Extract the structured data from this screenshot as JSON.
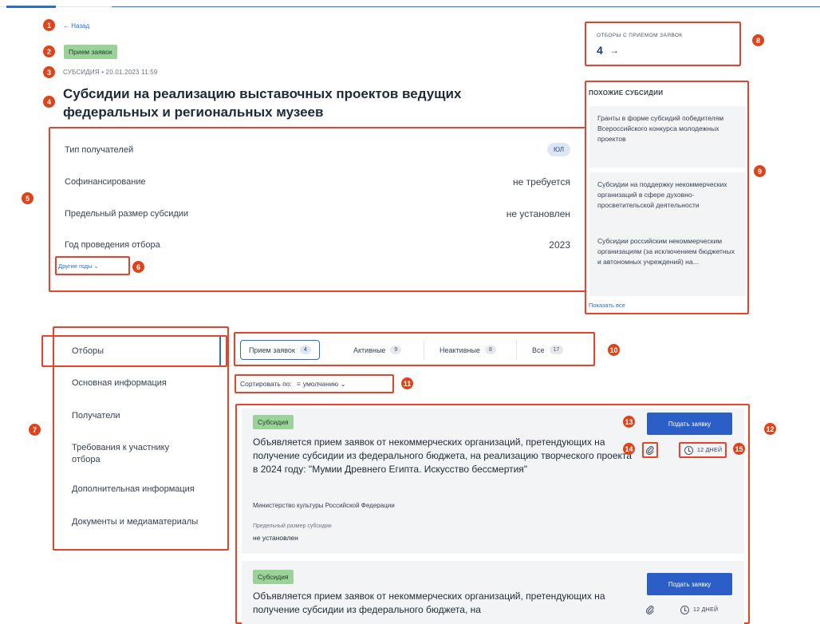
{
  "header": {
    "back": "← Назад",
    "status": "Прием заявок",
    "meta": "СУБСИДИЯ • 20.01.2023 11:59",
    "title": "Субсидии на реализацию выставочных проектов ведущих федеральных и региональных музеев"
  },
  "info": {
    "rows": [
      {
        "label": "Тип получателей",
        "value": "ЮЛ"
      },
      {
        "label": "Софинансирование",
        "value": "не требуется"
      },
      {
        "label": "Предельный размер субсидии",
        "value": "не установлен"
      },
      {
        "label": "Год проведения отбора",
        "value": "2023"
      }
    ],
    "other_years": "Другие годы ⌄"
  },
  "selections": {
    "label": "ОТБОРЫ С ПРИЕМОМ ЗАЯВОК",
    "count": "4",
    "arrow": "→"
  },
  "similar": {
    "title": "ПОХОЖИЕ СУБСИДИИ",
    "items": [
      "Гранты в форме субсидий победителям Всероссийского конкурса молодежных проектов",
      "Субсидии на поддержку некоммерческих организаций в сфере духовно-просветительской деятельности",
      "Субсидии российским некоммерческим организациям (за исключением бюджетных и автономных учреждений) на..."
    ],
    "show_all": "Показать все"
  },
  "nav": {
    "items": [
      "Отборы",
      "Основная информация",
      "Получатели",
      "Требования к участнику отбора",
      "Дополнительная информация",
      "Документы и медиаматериалы"
    ]
  },
  "tabs": [
    {
      "label": "Прием заявок",
      "count": "4"
    },
    {
      "label": "Активные",
      "count": "9"
    },
    {
      "label": "Неактивные",
      "count": "8"
    },
    {
      "label": "Все",
      "count": "17"
    }
  ],
  "sort": {
    "label": "Сортировать по:",
    "icon": "≡",
    "value": "умолчанию ⌄"
  },
  "cards": [
    {
      "chip": "Субсидия",
      "title": "Объявляется прием заявок от некоммерческих организаций, претендующих на получение субсидии из федерального бюджета, на реализацию творческого проекта в 2024 году: \"Мумии Древнего Египта. Искусство бессмертия\"",
      "ministry": "Министерство культуры Российской Федерации",
      "limit_label": "Предельный размер субсидии",
      "limit_value": "не установлен",
      "apply": "Подать заявку",
      "days": "12 ДНЕЙ"
    },
    {
      "chip": "Субсидия",
      "title": "Объявляется прием заявок от некоммерческих организаций, претендующих на получение субсидии из федерального бюджета, на",
      "apply": "Подать заявку",
      "days": "12 ДНЕЙ"
    }
  ],
  "markers": [
    "1",
    "2",
    "3",
    "4",
    "5",
    "6",
    "7",
    "8",
    "9",
    "10",
    "11",
    "12",
    "13",
    "14",
    "15"
  ],
  "colors": {
    "accent": "#2b6dd6",
    "marker": "#e0421a",
    "chip": "#9bd29a",
    "button": "#2b5fc7"
  }
}
